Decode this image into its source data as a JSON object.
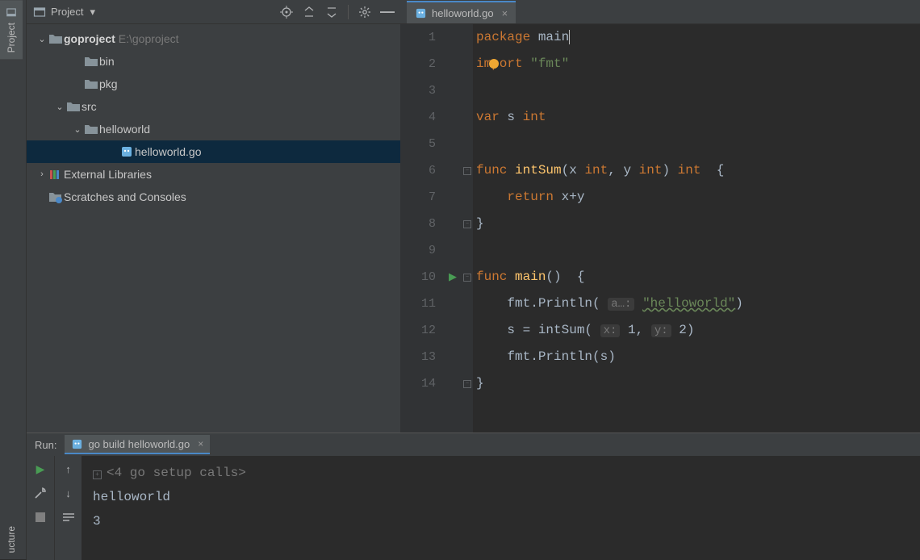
{
  "sidebar": {
    "project_label": "Project",
    "structure_label": "ucture"
  },
  "project_panel": {
    "title": "Project",
    "root": {
      "name": "goproject",
      "path": "E:\\goproject"
    },
    "bin": "bin",
    "pkg": "pkg",
    "src": "src",
    "helloworld_dir": "helloworld",
    "helloworld_file": "helloworld.go",
    "external_libs": "External Libraries",
    "scratches": "Scratches and Consoles"
  },
  "editor": {
    "tab_name": "helloworld.go",
    "lines": [
      "1",
      "2",
      "3",
      "4",
      "5",
      "6",
      "7",
      "8",
      "9",
      "10",
      "11",
      "12",
      "13",
      "14"
    ],
    "code": {
      "l1_kw": "package ",
      "l1_id": "main",
      "l2_kw": "import ",
      "l2_str": "\"fmt\"",
      "l4_kw": "var ",
      "l4_id": "s ",
      "l4_type": "int",
      "l6_kw": "func ",
      "l6_fn": "intSum",
      "l6_sig1": "(x ",
      "l6_t1": "int",
      "l6_sig2": ", y ",
      "l6_t2": "int",
      "l6_sig3": ") ",
      "l6_ret": "int",
      "l6_brace": "  {",
      "l7_kw": "return ",
      "l7_expr": "x+y",
      "l8": "}",
      "l10_kw": "func ",
      "l10_fn": "main",
      "l10_rest": "()  {",
      "l11_pre": "fmt.Println( ",
      "l11_hint": "a…:",
      "l11_str": "\"helloworld\"",
      "l11_post": ")",
      "l12_pre": "s = intSum( ",
      "l12_h1": "x:",
      "l12_v1": " 1",
      "l12_c": ", ",
      "l12_h2": "y:",
      "l12_v2": " 2",
      "l12_post": ")",
      "l13": "fmt.Println(s)",
      "l14": "}"
    }
  },
  "run": {
    "label": "Run:",
    "tab": "go build helloworld.go",
    "fold_text": "<4 go setup calls>",
    "out1": "helloworld",
    "out2": "3"
  }
}
